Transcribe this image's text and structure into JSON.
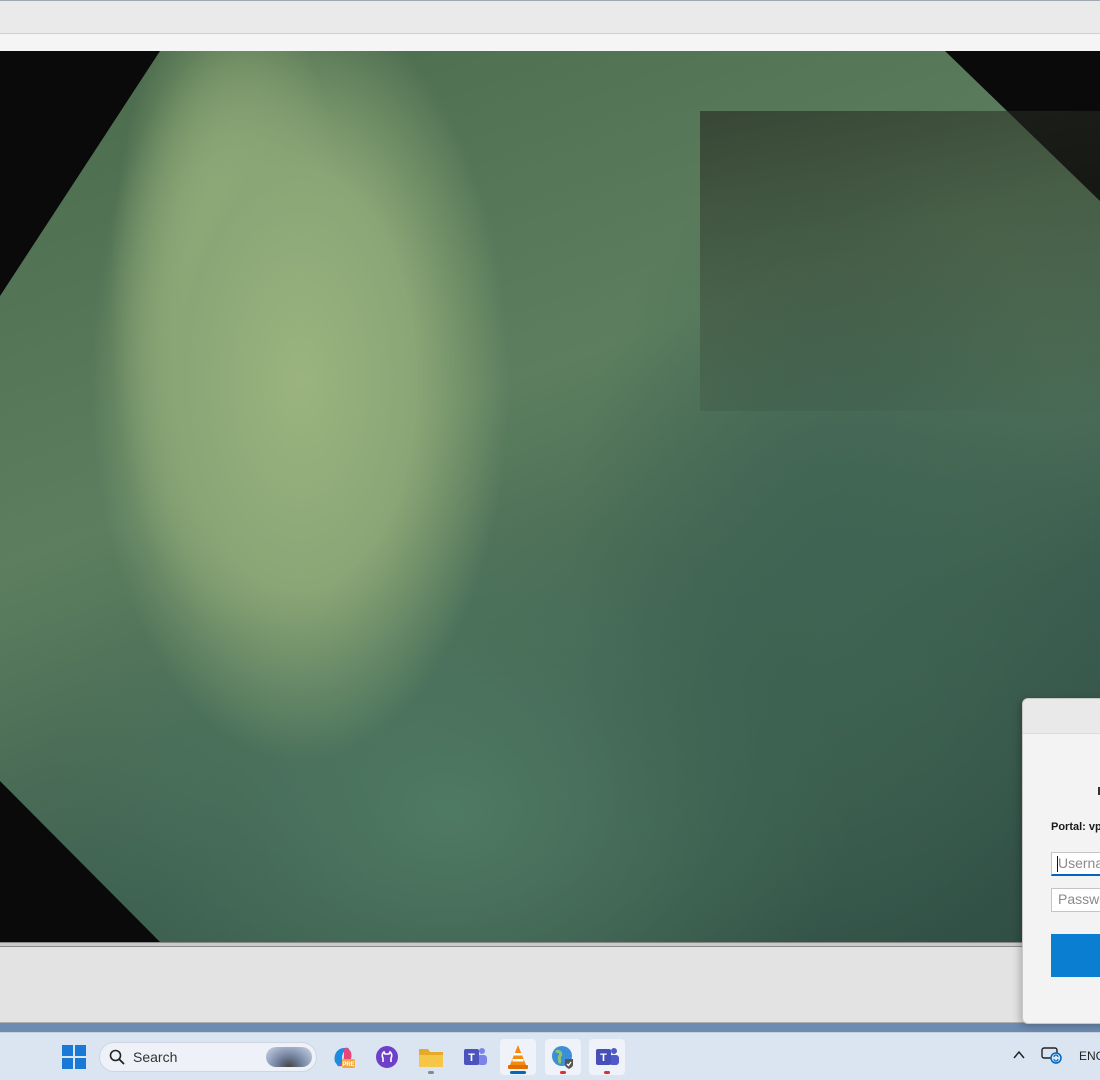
{
  "dialog": {
    "portal_label": "Portal: vp",
    "username_placeholder": "Userna",
    "password_placeholder": "Passwo"
  },
  "taskbar": {
    "search_label": "Search",
    "apps": [
      {
        "name": "copilot-icon",
        "status": "none"
      },
      {
        "name": "github-desktop-icon",
        "status": "none"
      },
      {
        "name": "file-explorer-icon",
        "status": "running"
      },
      {
        "name": "teams-icon",
        "status": "none"
      },
      {
        "name": "vlc-icon",
        "status": "active"
      },
      {
        "name": "globe-vpn-icon",
        "status": "alert"
      },
      {
        "name": "teams-classic-icon",
        "status": "alert"
      }
    ],
    "tray": {
      "language": "ENG"
    }
  },
  "colors": {
    "accent": "#0067c0",
    "connect_button": "#0a7fd1",
    "taskbar_bg": "#dbe5f2"
  }
}
